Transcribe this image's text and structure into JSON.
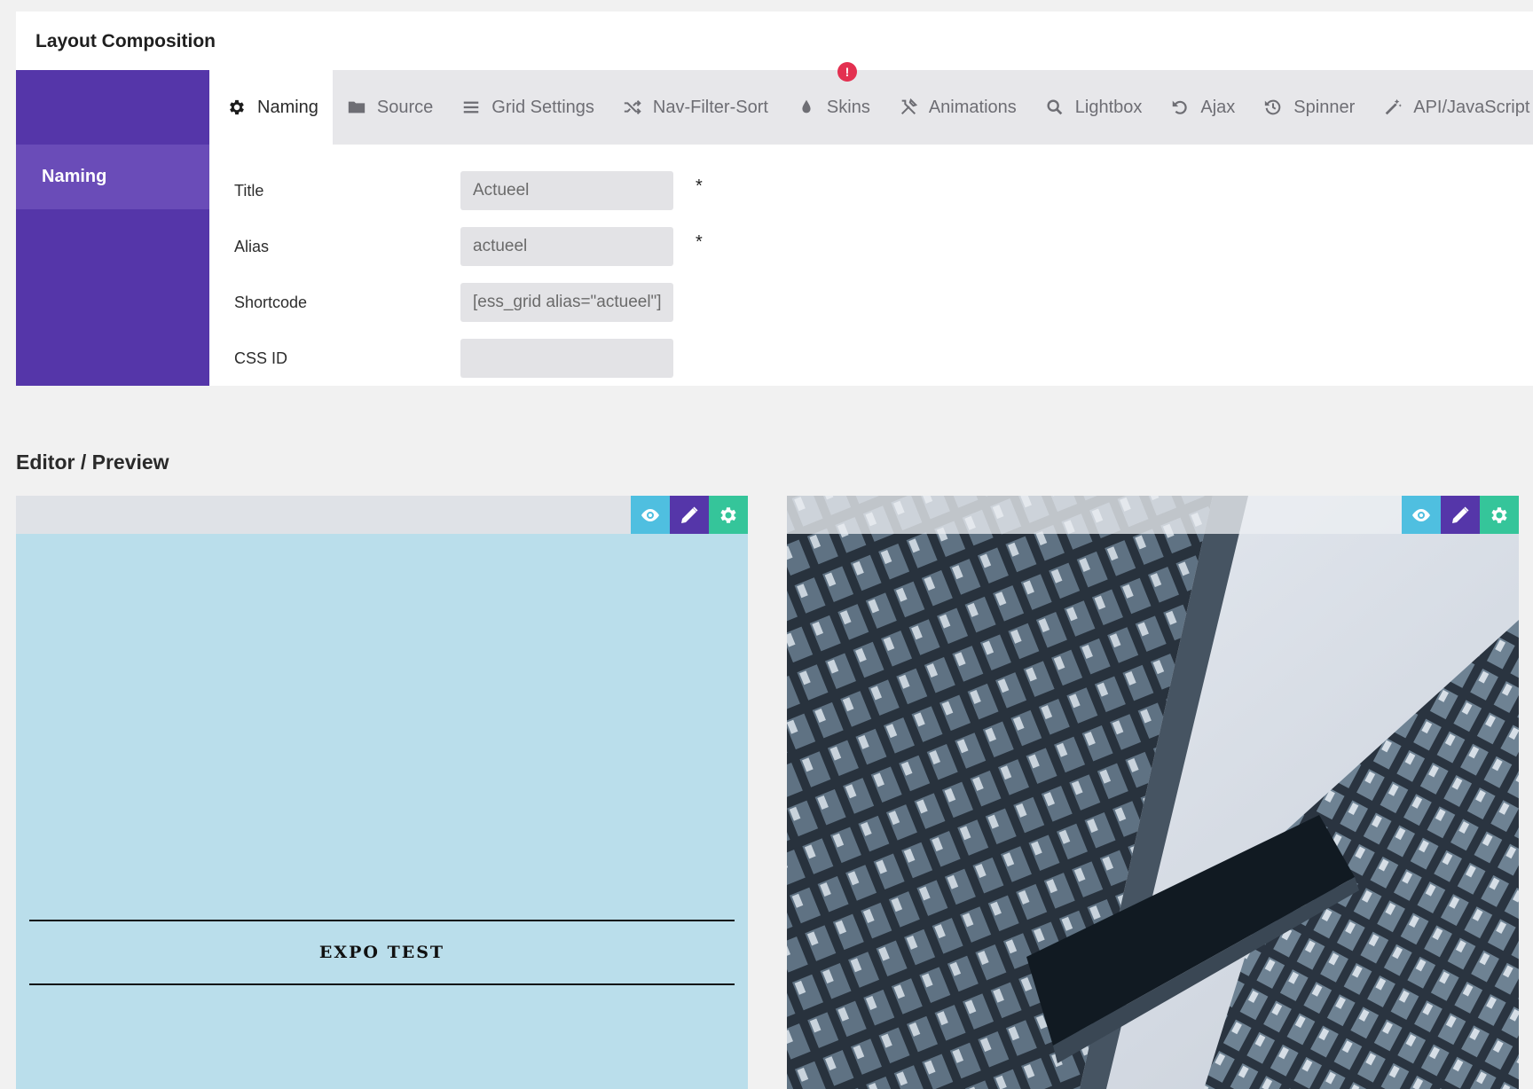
{
  "layout_composition": {
    "title": "Layout Composition",
    "side_nav": {
      "active_item": "Naming"
    },
    "tabs": [
      {
        "label": "Naming",
        "icon": "gear-icon",
        "active": true
      },
      {
        "label": "Source",
        "icon": "folder-icon"
      },
      {
        "label": "Grid Settings",
        "icon": "menu-lines-icon"
      },
      {
        "label": "Nav-Filter-Sort",
        "icon": "shuffle-icon"
      },
      {
        "label": "Skins",
        "icon": "droplet-icon",
        "badge": "!"
      },
      {
        "label": "Animations",
        "icon": "tools-icon"
      },
      {
        "label": "Lightbox",
        "icon": "search-icon"
      },
      {
        "label": "Ajax",
        "icon": "undo-icon"
      },
      {
        "label": "Spinner",
        "icon": "history-icon"
      },
      {
        "label": "API/JavaScript",
        "icon": "magic-wand-icon"
      }
    ],
    "form": {
      "title": {
        "label": "Title",
        "value": "Actueel",
        "required": "*"
      },
      "alias": {
        "label": "Alias",
        "value": "actueel",
        "required": "*"
      },
      "shortcode": {
        "label": "Shortcode",
        "value": "[ess_grid alias=\"actueel\"]"
      },
      "css_id": {
        "label": "CSS ID",
        "value": ""
      }
    }
  },
  "editor_preview": {
    "title": "Editor / Preview",
    "items": [
      {
        "caption": "EXPO TEST",
        "background": "#badeeb"
      },
      {
        "caption": "",
        "image": "building-photo"
      }
    ]
  },
  "colors": {
    "accent_purple": "#5536a9",
    "view_blue": "#4fbfe0",
    "settings_green": "#35c59a",
    "alert_red": "#e33050"
  }
}
